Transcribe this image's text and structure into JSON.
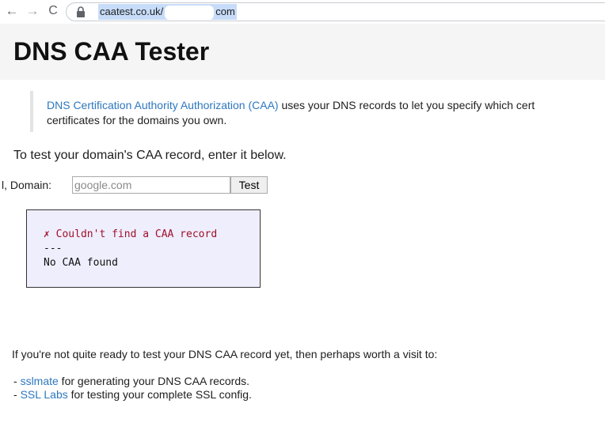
{
  "browser": {
    "back_icon": "←",
    "forward_icon": "→",
    "reload_icon": "C",
    "url_prefix": "caatest.co.uk/",
    "url_suffix": "com"
  },
  "page": {
    "title": "DNS CAA Tester"
  },
  "intro": {
    "link_text": "DNS Certification Authority Authorization (CAA)",
    "text_line1": " uses your DNS records to let you specify which cert",
    "text_line2": "certificates for the domains you own."
  },
  "prompt": "To test your domain's CAA record, enter it below.",
  "form": {
    "label": "l, Domain:",
    "placeholder": "google.com",
    "button_label": "Test"
  },
  "result": {
    "error_line": "✗ Couldn't find a CAA record",
    "separator": "---",
    "detail": "No CAA found",
    "box_color": "#efeefd",
    "error_color": "#a0102a"
  },
  "visit_text": "If you're not quite ready to test your DNS CAA record yet, then perhaps worth a visit to:",
  "resources": [
    {
      "prefix": "- ",
      "link": "sslmate",
      "text": " for generating your DNS CAA records."
    },
    {
      "prefix": "- ",
      "link": "SSL Labs",
      "text": " for testing your complete SSL config."
    }
  ],
  "colors": {
    "link": "#2d77bf",
    "header_bg": "#f5f5f5",
    "url_highlight": "#c7dcf8"
  }
}
